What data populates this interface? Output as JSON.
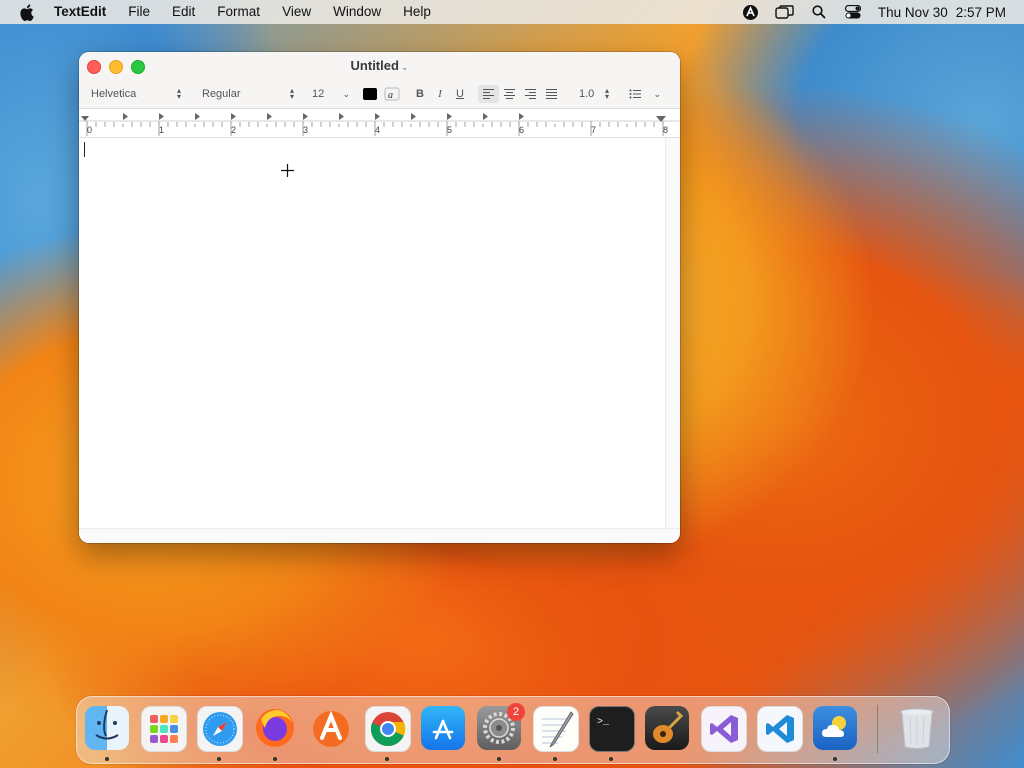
{
  "menubar": {
    "app_name": "TextEdit",
    "menus": [
      "File",
      "Edit",
      "Format",
      "View",
      "Window",
      "Help"
    ],
    "status_icons": [
      "vpn-icon",
      "screen-mirroring-icon",
      "spotlight-search-icon",
      "control-center-icon"
    ],
    "date": "Thu Nov 30",
    "time": "2:57 PM"
  },
  "window": {
    "title": "Untitled",
    "toolbar": {
      "font_family": "Helvetica",
      "font_style": "Regular",
      "font_size": "12",
      "text_color": "#000000",
      "bold_label": "B",
      "italic_label": "I",
      "underline_label": "U",
      "alignment": "left",
      "line_spacing": "1.0"
    },
    "ruler": {
      "labels": [
        "0",
        "1",
        "2",
        "3",
        "4",
        "5",
        "6",
        "7",
        "8"
      ]
    },
    "document_text": ""
  },
  "dock": {
    "apps": [
      {
        "name": "Finder",
        "icon": "finder-icon",
        "running": true
      },
      {
        "name": "Launchpad",
        "icon": "launchpad-icon",
        "running": false
      },
      {
        "name": "Safari",
        "icon": "safari-icon",
        "running": true
      },
      {
        "name": "Firefox",
        "icon": "firefox-icon",
        "running": true
      },
      {
        "name": "Avast",
        "icon": "avast-icon",
        "running": false
      },
      {
        "name": "Google Chrome",
        "icon": "chrome-icon",
        "running": true
      },
      {
        "name": "App Store",
        "icon": "app-store-icon",
        "running": false
      },
      {
        "name": "System Settings",
        "icon": "system-settings-icon",
        "running": true,
        "badge": "2"
      },
      {
        "name": "TextEdit",
        "icon": "textedit-icon",
        "running": true
      },
      {
        "name": "Terminal",
        "icon": "terminal-icon",
        "running": true
      },
      {
        "name": "GarageBand",
        "icon": "garageband-icon",
        "running": false
      },
      {
        "name": "Visual Studio",
        "icon": "visual-studio-icon",
        "running": false
      },
      {
        "name": "Visual Studio Code",
        "icon": "vscode-icon",
        "running": false
      },
      {
        "name": "Weather",
        "icon": "weather-icon",
        "running": true
      },
      {
        "name": "Trash",
        "icon": "trash-icon",
        "running": false
      }
    ]
  }
}
